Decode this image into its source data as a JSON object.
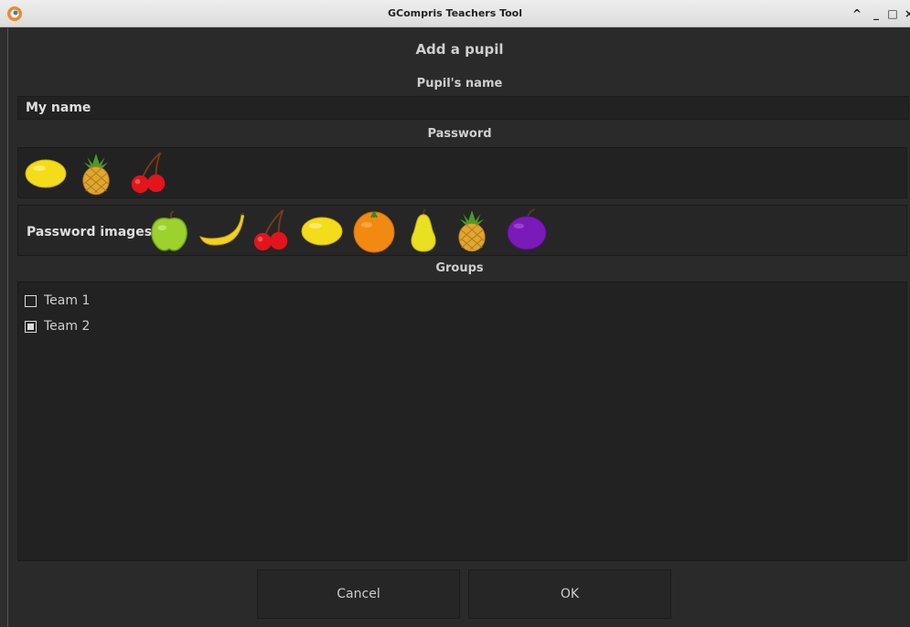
{
  "window": {
    "title": "GCompris Teachers Tool",
    "controls": [
      "^",
      "_",
      "□",
      "×"
    ]
  },
  "dialog": {
    "title": "Add a pupil",
    "name_section": "Pupil's name",
    "name_value": "My name",
    "password_section": "Password",
    "password_fruits": [
      "lemon-icon",
      "pineapple-icon",
      "cherries-icon"
    ],
    "images_label": "Password images:",
    "available_images": [
      "apple-icon",
      "banana-icon",
      "cherries-icon",
      "lemon-icon",
      "orange-icon",
      "pear-icon",
      "pineapple-icon",
      "plum-icon"
    ],
    "groups_section": "Groups",
    "groups": [
      {
        "label": "Team 1",
        "checked": false
      },
      {
        "label": "Team 2",
        "checked": true
      }
    ],
    "cancel_label": "Cancel",
    "ok_label": "OK"
  },
  "colors": {
    "background": "#2d2d2d",
    "panel": "#222222",
    "text": "#d6d6d6"
  }
}
